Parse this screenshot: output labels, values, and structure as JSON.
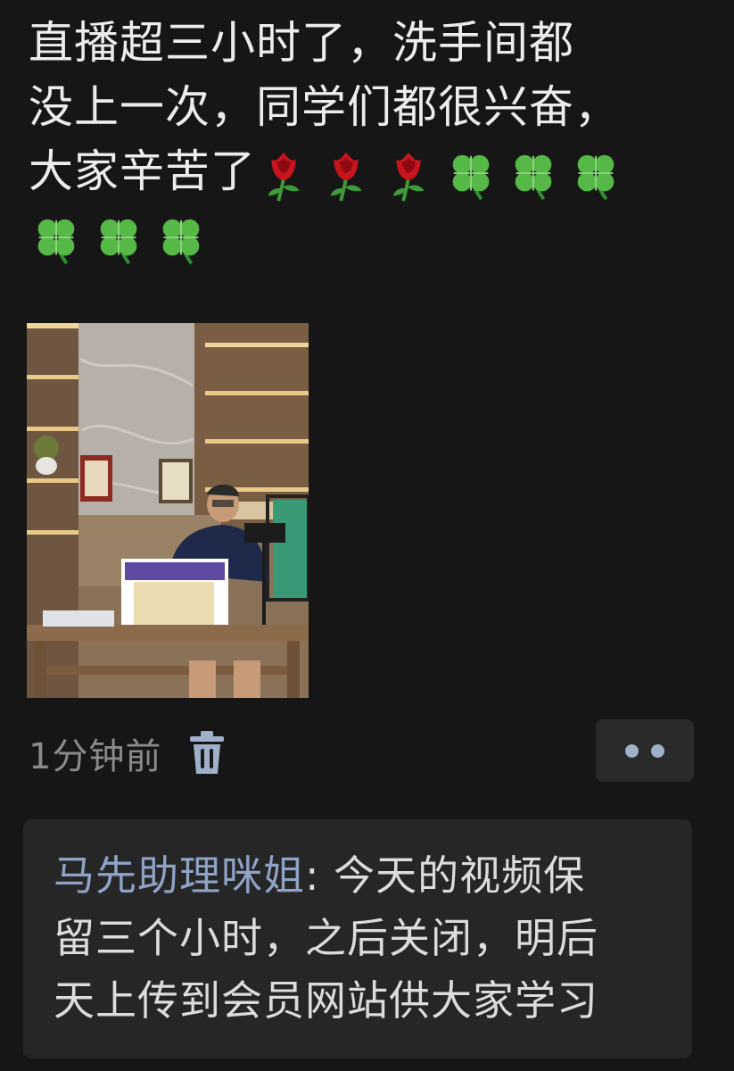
{
  "post": {
    "text_line1": "直播超三小时了，洗手间都",
    "text_line2": "没上一次，同学们都很兴奋，",
    "text_line3": "大家辛苦了",
    "emojis": [
      "rose",
      "rose",
      "rose",
      "four-leaf-clover",
      "four-leaf-clover",
      "four-leaf-clover",
      "four-leaf-clover",
      "four-leaf-clover",
      "four-leaf-clover"
    ],
    "time_ago": "1分钟前"
  },
  "comment": {
    "author": "马先助理咪姐",
    "separator": ": ",
    "line1": "今天的视频保",
    "line2": "留三个小时，之后关闭，明后",
    "line3": "天上传到会员网站供大家学习"
  },
  "colors": {
    "background": "#161616",
    "author_link": "#8ea3c6",
    "comment_box": "#262626"
  },
  "icons": {
    "delete": "trash-icon",
    "more": "more-dots-icon"
  }
}
